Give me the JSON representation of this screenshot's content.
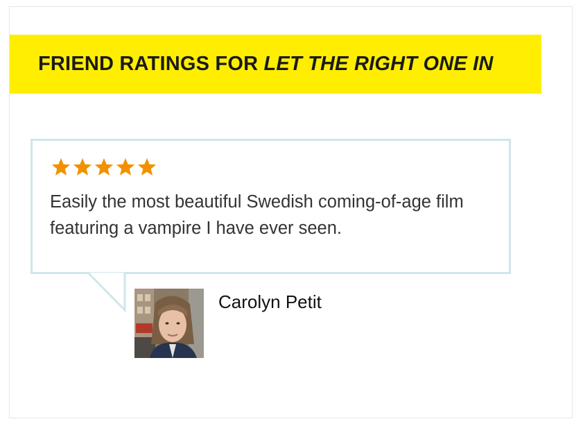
{
  "banner": {
    "prefix": "FRIEND RATINGS FOR ",
    "movie_title": "LET THE RIGHT ONE IN",
    "background_color": "#ffee00"
  },
  "review": {
    "rating": 5,
    "max_rating": 5,
    "star_color": "#f29100",
    "text": "Easily the most beautiful Swedish coming-of-age film featuring a vampire I have ever seen.",
    "reviewer_name": "Carolyn Petit",
    "avatar_icon": "user-photo"
  },
  "colors": {
    "bubble_border": "#cfe6ea",
    "frame_border": "#e6e6e6"
  }
}
